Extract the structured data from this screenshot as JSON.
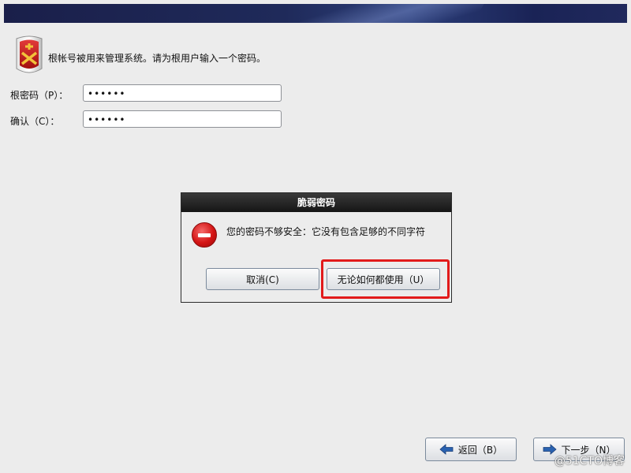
{
  "installer": {
    "description": "根帐号被用来管理系统。请为根用户输入一个密码。",
    "root_password_label": "根密码（P）：",
    "root_password_value": "••••••",
    "confirm_label": "确认（C）：",
    "confirm_value": "••••••"
  },
  "dialog": {
    "title": "脆弱密码",
    "message": "您的密码不够安全：它没有包含足够的不同字符",
    "cancel_label": "取消(C)",
    "use_anyway_label": "无论如何都使用（U）"
  },
  "nav": {
    "back_label": "返回（B）",
    "next_label": "下一步（N）"
  },
  "watermark": "@51CTO博客",
  "colors": {
    "highlight": "#e21b1b",
    "error_icon": "#d41414",
    "arrow": "#2a62b0"
  }
}
